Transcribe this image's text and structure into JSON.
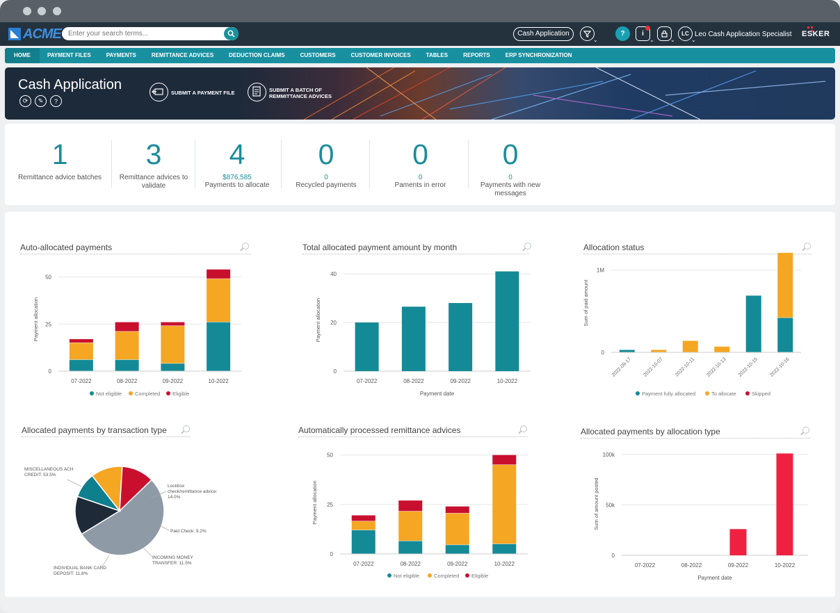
{
  "search": {
    "placeholder": "Enter your search terms..."
  },
  "header": {
    "app_button": "Cash Application",
    "user_initials": "LC",
    "user_name": "Leo Cash Application Specialist",
    "brand": "ESKER",
    "logo": "ACME"
  },
  "nav": [
    "HOME",
    "PAYMENT FILES",
    "PAYMENTS",
    "REMITTANCE ADVICES",
    "DEDUCTION CLAIMS",
    "CUSTOMERS",
    "CUSTOMER INVOICES",
    "TABLES",
    "REPORTS",
    "ERP SYNCHRONIZATION"
  ],
  "banner": {
    "title": "Cash Application",
    "action1": "SUBMIT A PAYMENT FILE",
    "action2_line1": "SUBMIT A BATCH OF",
    "action2_line2": "REMMITTANCE ADVICES"
  },
  "kpis": [
    {
      "value": "1",
      "sub": "",
      "label1": "Remittance advice batches",
      "label2": ""
    },
    {
      "value": "3",
      "sub": "",
      "label1": "Remittance advices to",
      "label2": "validate"
    },
    {
      "value": "4",
      "sub": "$876,585",
      "label1": "Payments to allocate",
      "label2": ""
    },
    {
      "value": "0",
      "sub": "0",
      "label1": "Recycled payments",
      "label2": ""
    },
    {
      "value": "0",
      "sub": "0",
      "label1": "Paments in error",
      "label2": ""
    },
    {
      "value": "0",
      "sub": "0",
      "label1": "Payments with new",
      "label2": "messages"
    }
  ],
  "colors": {
    "teal": "#148a97",
    "orange": "#f5a623",
    "red": "#c8102e",
    "grey": "#8e9aa6",
    "navy": "#1e2a38",
    "teal2": "#0e7f8d",
    "brightred": "#ef2140"
  },
  "chart_data": [
    {
      "type": "bar",
      "stacked": true,
      "title": "Auto-allocated payments",
      "ylabel": "Payment allocation",
      "xlabel": "",
      "categories": [
        "07-2022",
        "08-2022",
        "09-2022",
        "10-2022"
      ],
      "yticks": [
        "0",
        "25",
        "50"
      ],
      "ylim": [
        0,
        55
      ],
      "series": [
        {
          "name": "Not eligible",
          "values": [
            6,
            6,
            4,
            26
          ]
        },
        {
          "name": "Completed",
          "values": [
            9,
            15,
            20,
            23
          ]
        },
        {
          "name": "Eligible",
          "values": [
            2,
            5,
            2,
            5
          ]
        }
      ]
    },
    {
      "type": "bar",
      "title": "Total allocated payment amount by month",
      "ylabel": "Payment allocation",
      "xlabel": "Payment date",
      "categories": [
        "07-2022",
        "08-2022",
        "09-2022",
        "10-2022"
      ],
      "yticks": [
        "0",
        "20",
        "40"
      ],
      "ylim": [
        0,
        42
      ],
      "values": [
        20,
        26.5,
        28,
        41
      ]
    },
    {
      "type": "bar",
      "stacked": true,
      "title": "Allocation status",
      "ylabel": "Sum of paid amount",
      "xlabel": "",
      "categories": [
        "2022-09-17",
        "2022-10-07",
        "2022-10-11",
        "2022-10-13",
        "2022-10-15",
        "2022-10-16"
      ],
      "yticks": [
        "0",
        "1M"
      ],
      "ylim": [
        0,
        1.2
      ],
      "series": [
        {
          "name": "Payment fully allocated",
          "values": [
            0.03,
            0,
            0,
            0,
            0.69,
            0.42
          ]
        },
        {
          "name": "To allocate",
          "values": [
            0,
            0.03,
            0.14,
            0.07,
            0,
            0.79
          ]
        },
        {
          "name": "Skipped",
          "values": [
            0,
            0,
            0,
            0,
            0,
            0
          ]
        }
      ]
    },
    {
      "type": "pie",
      "title": "Allocated payments by transaction type",
      "slices": [
        {
          "label1": "MISCELLANEOUS ACH",
          "label2": "CREDIT: 53.5%",
          "value": 53.5
        },
        {
          "label1": "Lockbox",
          "label2": "check/remittance advice:",
          "label3": "14.0%",
          "value": 14.0
        },
        {
          "label1": "Paid Check: 9.2%",
          "value": 9.2
        },
        {
          "label1": "INCOMING MONEY",
          "label2": "TRANSFER: 11.5%",
          "value": 11.5
        },
        {
          "label1": "INDIVIDUAL BANK CARD",
          "label2": "DEPOSIT: 11.8%",
          "value": 11.8
        }
      ]
    },
    {
      "type": "bar",
      "stacked": true,
      "title": "Automatically processed remittance advices",
      "ylabel": "Payment allocation",
      "xlabel": "",
      "categories": [
        "07-2022",
        "08-2022",
        "09-2022",
        "10-2022"
      ],
      "yticks": [
        "0",
        "25",
        "50"
      ],
      "ylim": [
        0,
        52
      ],
      "series": [
        {
          "name": "Not eligible",
          "values": [
            12,
            6.5,
            4.5,
            5
          ]
        },
        {
          "name": "Completed",
          "values": [
            4.5,
            15,
            16,
            40
          ]
        },
        {
          "name": "Eligible",
          "values": [
            3,
            5.5,
            3.5,
            5
          ]
        }
      ]
    },
    {
      "type": "bar",
      "title": "Allocated payments by allocation type",
      "ylabel": "Sum of amount posted",
      "xlabel": "Payment date",
      "categories": [
        "07-2022",
        "08-2022",
        "09-2022",
        "10-2022"
      ],
      "yticks": [
        "0",
        "50k",
        "100k"
      ],
      "ylim": [
        0,
        102
      ],
      "values": [
        0,
        0,
        26,
        101
      ]
    }
  ]
}
